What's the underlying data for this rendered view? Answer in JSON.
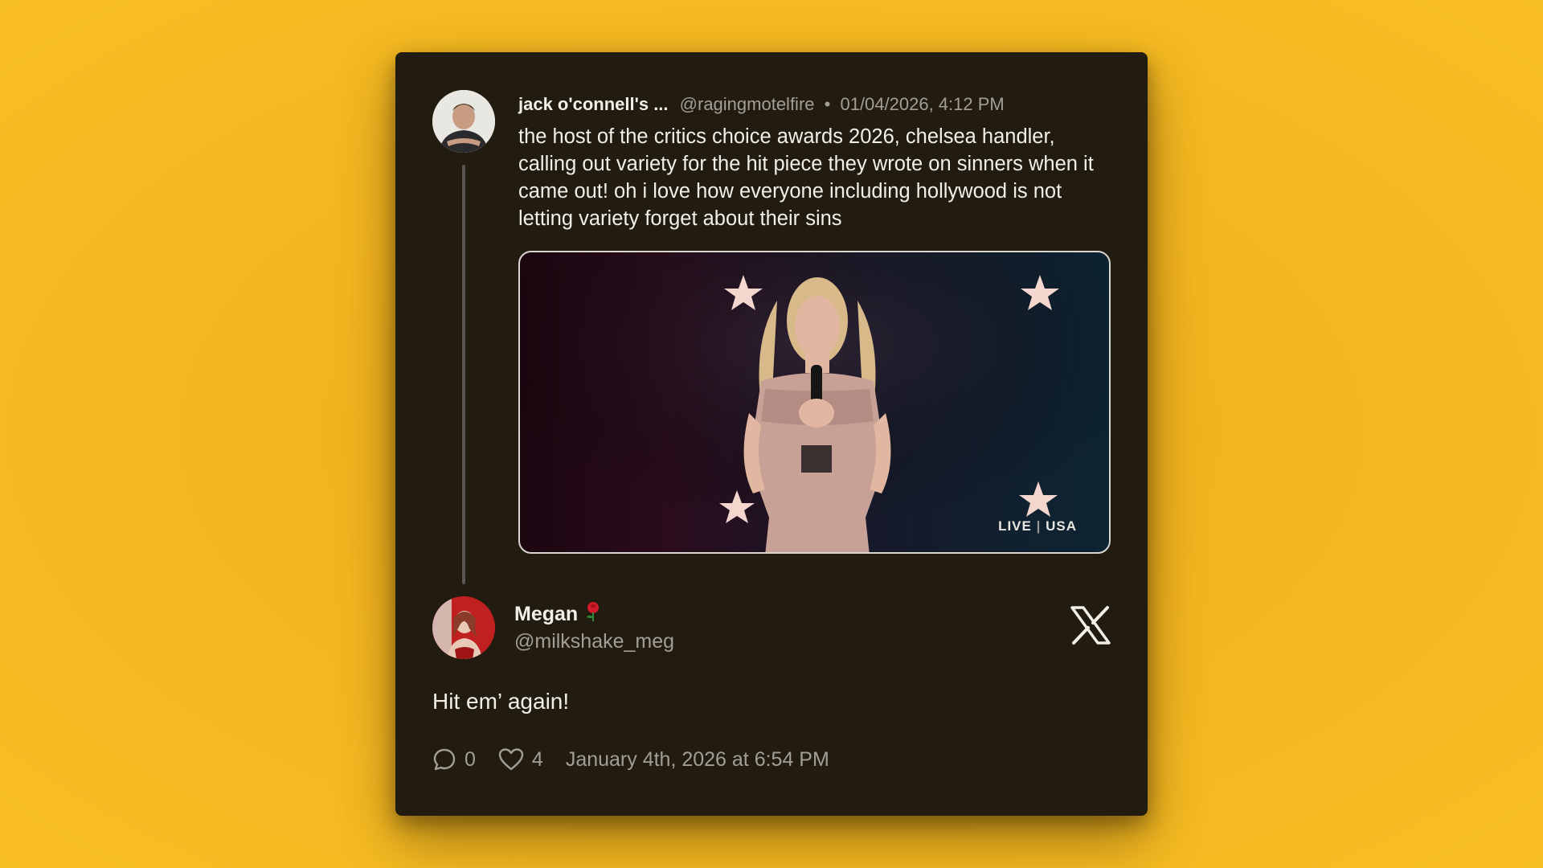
{
  "original_tweet": {
    "author_name": "jack o'connell's ...",
    "author_handle": "@ragingmotelfire",
    "separator": "•",
    "timestamp": "01/04/2026, 4:12 PM",
    "text": "the host of the critics choice awards 2026, chelsea handler, calling out variety for the hit piece they wrote on sinners when it came out! oh i love how everyone including hollywood is not letting variety forget about their sins",
    "media": {
      "badge_live": "LIVE",
      "badge_network": "USA"
    }
  },
  "reply": {
    "author_name": "Megan",
    "name_emoji_icon": "rose-icon",
    "author_handle": "@milkshake_meg",
    "text": "Hit em’ again!",
    "replies_count": "0",
    "likes_count": "4",
    "timestamp": "January 4th, 2026 at 6:54 PM"
  },
  "icons": {
    "platform": "x-logo-icon",
    "replies": "comment-icon",
    "likes": "heart-icon"
  },
  "colors": {
    "background": "#f8bf24",
    "card": "#211b10",
    "text_primary": "#f2efe8",
    "text_secondary": "#a39e96"
  }
}
